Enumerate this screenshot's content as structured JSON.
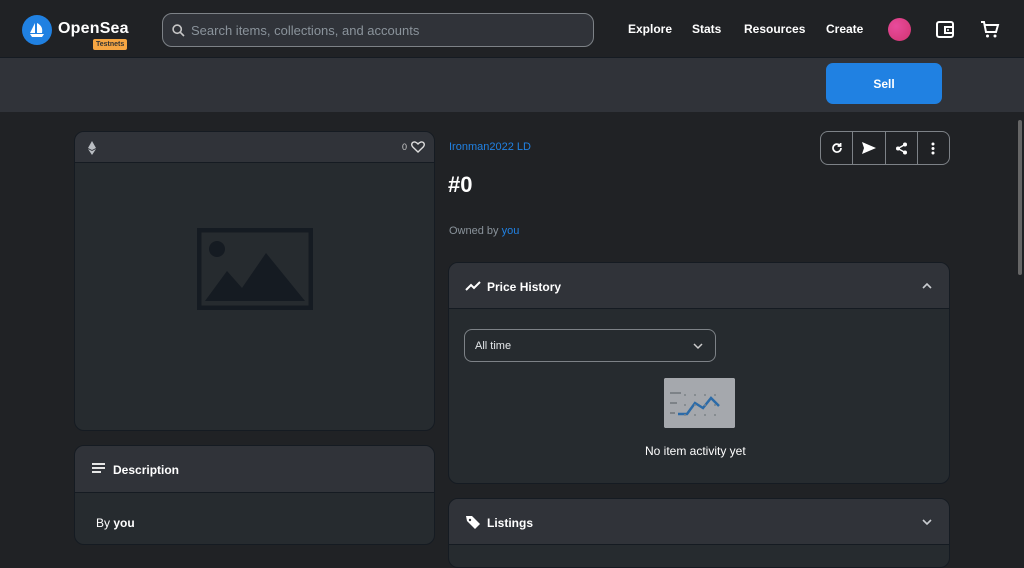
{
  "header": {
    "brand": "OpenSea",
    "badge": "Testnets",
    "search_placeholder": "Search items, collections, and accounts",
    "nav": [
      "Explore",
      "Stats",
      "Resources",
      "Create"
    ],
    "icons": [
      "opensea-logo-icon",
      "search-icon",
      "avatar",
      "wallet-icon",
      "cart-icon"
    ]
  },
  "toolbar": {
    "sell_label": "Sell"
  },
  "asset": {
    "like_count": "0",
    "collection": "Ironman2022 LD",
    "token_id": "#0",
    "owned_prefix": "Owned by",
    "owner": "you",
    "image_icon": "image-placeholder-icon"
  },
  "description": {
    "title": "Description",
    "by_prefix": "By",
    "creator": "you"
  },
  "price_history": {
    "title": "Price History",
    "selected_range": "All time",
    "empty_text": "No item activity yet"
  },
  "listings": {
    "title": "Listings"
  },
  "colors": {
    "background": "#202225",
    "panel": "#262b2f",
    "accent": "#2081e2",
    "badge": "#f5a542",
    "avatar": "#d13470"
  }
}
